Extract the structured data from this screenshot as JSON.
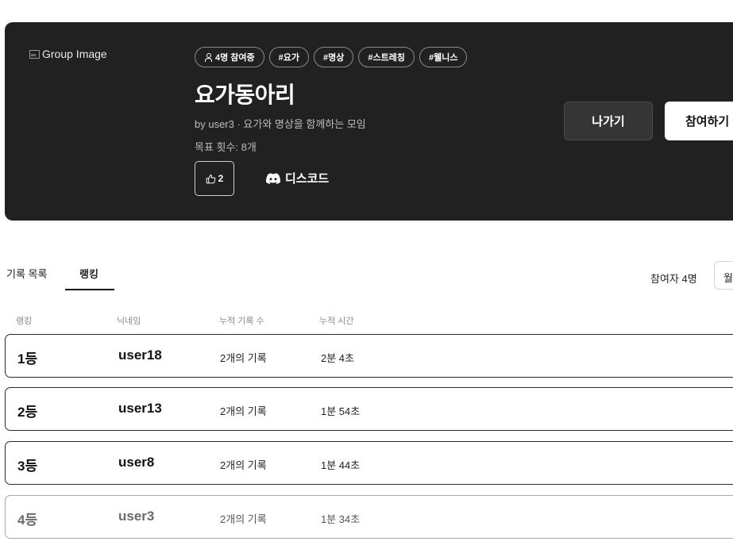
{
  "group": {
    "image_alt": "Group Image",
    "member_badge": "4명 참여중",
    "tags": [
      "#요가",
      "#명상",
      "#스트레칭",
      "#웰니스"
    ],
    "title": "요가동아리",
    "subtitle": "by user3 · 요가와 명상을 함께하는 모임",
    "goal": "목표 횟수: 8개",
    "likes": "2",
    "discord_label": "디스코드",
    "leave_label": "나가기",
    "join_label": "참여하기"
  },
  "tabs": {
    "records": "기록 목록",
    "ranking": "랭킹"
  },
  "participants": "참여자 4명",
  "period_select": {
    "value": "월"
  },
  "table": {
    "headers": {
      "rank": "랭킹",
      "nickname": "닉네임",
      "count": "누적 기록 수",
      "time": "누적 시간"
    },
    "rows": [
      {
        "rank": "1등",
        "nickname": "user18",
        "count": "2개의 기록",
        "time": "2분 4초"
      },
      {
        "rank": "2등",
        "nickname": "user13",
        "count": "2개의 기록",
        "time": "1분 54초"
      },
      {
        "rank": "3등",
        "nickname": "user8",
        "count": "2개의 기록",
        "time": "1분 44초"
      },
      {
        "rank": "4등",
        "nickname": "user3",
        "count": "2개의 기록",
        "time": "1분 34초"
      }
    ]
  },
  "icons": {
    "members": "person-icon",
    "like": "thumbs-up-icon",
    "discord": "discord-icon",
    "broken_image": "broken-image-icon"
  },
  "colors": {
    "header_bg": "#212121",
    "accent": "#111111"
  }
}
